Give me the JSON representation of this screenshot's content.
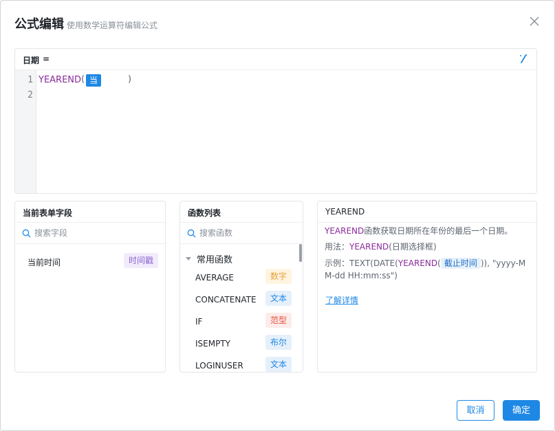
{
  "dialog": {
    "title": "公式编辑",
    "subtitle": "使用数学运算符编辑公式"
  },
  "editor": {
    "field_label": "日期",
    "equals": "=",
    "line_numbers": [
      "1",
      "2"
    ],
    "code": {
      "function": "YEAREND",
      "open_paren": "(",
      "field_chip": "当前时间",
      "close_paren": ")"
    }
  },
  "fields_panel": {
    "title": "当前表单字段",
    "search_placeholder": "搜索字段",
    "items": [
      {
        "name": "当前时间",
        "type": "时间戳"
      }
    ]
  },
  "functions_panel": {
    "title": "函数列表",
    "search_placeholder": "搜索函数",
    "group": "常用函数",
    "items": [
      {
        "name": "AVERAGE",
        "type": "数字"
      },
      {
        "name": "CONCATENATE",
        "type": "文本"
      },
      {
        "name": "IF",
        "type": "范型"
      },
      {
        "name": "ISEMPTY",
        "type": "布尔"
      },
      {
        "name": "LOGINUSER",
        "type": "文本"
      }
    ]
  },
  "detail_panel": {
    "title": "YEAREND",
    "desc_fn": "YEAREND",
    "desc_rest": "函数获取日期所在年份的最后一个日期。",
    "usage_label": "用法：",
    "usage_fn": "YEAREND",
    "usage_args": "(日期选择框)",
    "example_label": "示例：",
    "example_pre": "TEXT(DATE(",
    "example_fn": "YEAREND",
    "example_open": "(",
    "example_chip": "截止时间",
    "example_post1": ")),  \"yyyy-M",
    "example_post2": "M-dd HH:mm:ss\")",
    "more_link": "了解详情"
  },
  "footer": {
    "cancel_label": "取消",
    "ok_label": "确定"
  },
  "colors": {
    "primary": "#1e88e5",
    "function": "#8b2a9c",
    "tag_number_bg": "#fff4e0",
    "tag_number_fg": "#e8a33d",
    "tag_text_bg": "#e6f0fb",
    "tag_text_fg": "#1e88e5",
    "tag_generic_bg": "#fdeceb",
    "tag_generic_fg": "#e5533d",
    "tag_time_bg": "#f1ebfb",
    "tag_time_fg": "#8a63d2"
  }
}
